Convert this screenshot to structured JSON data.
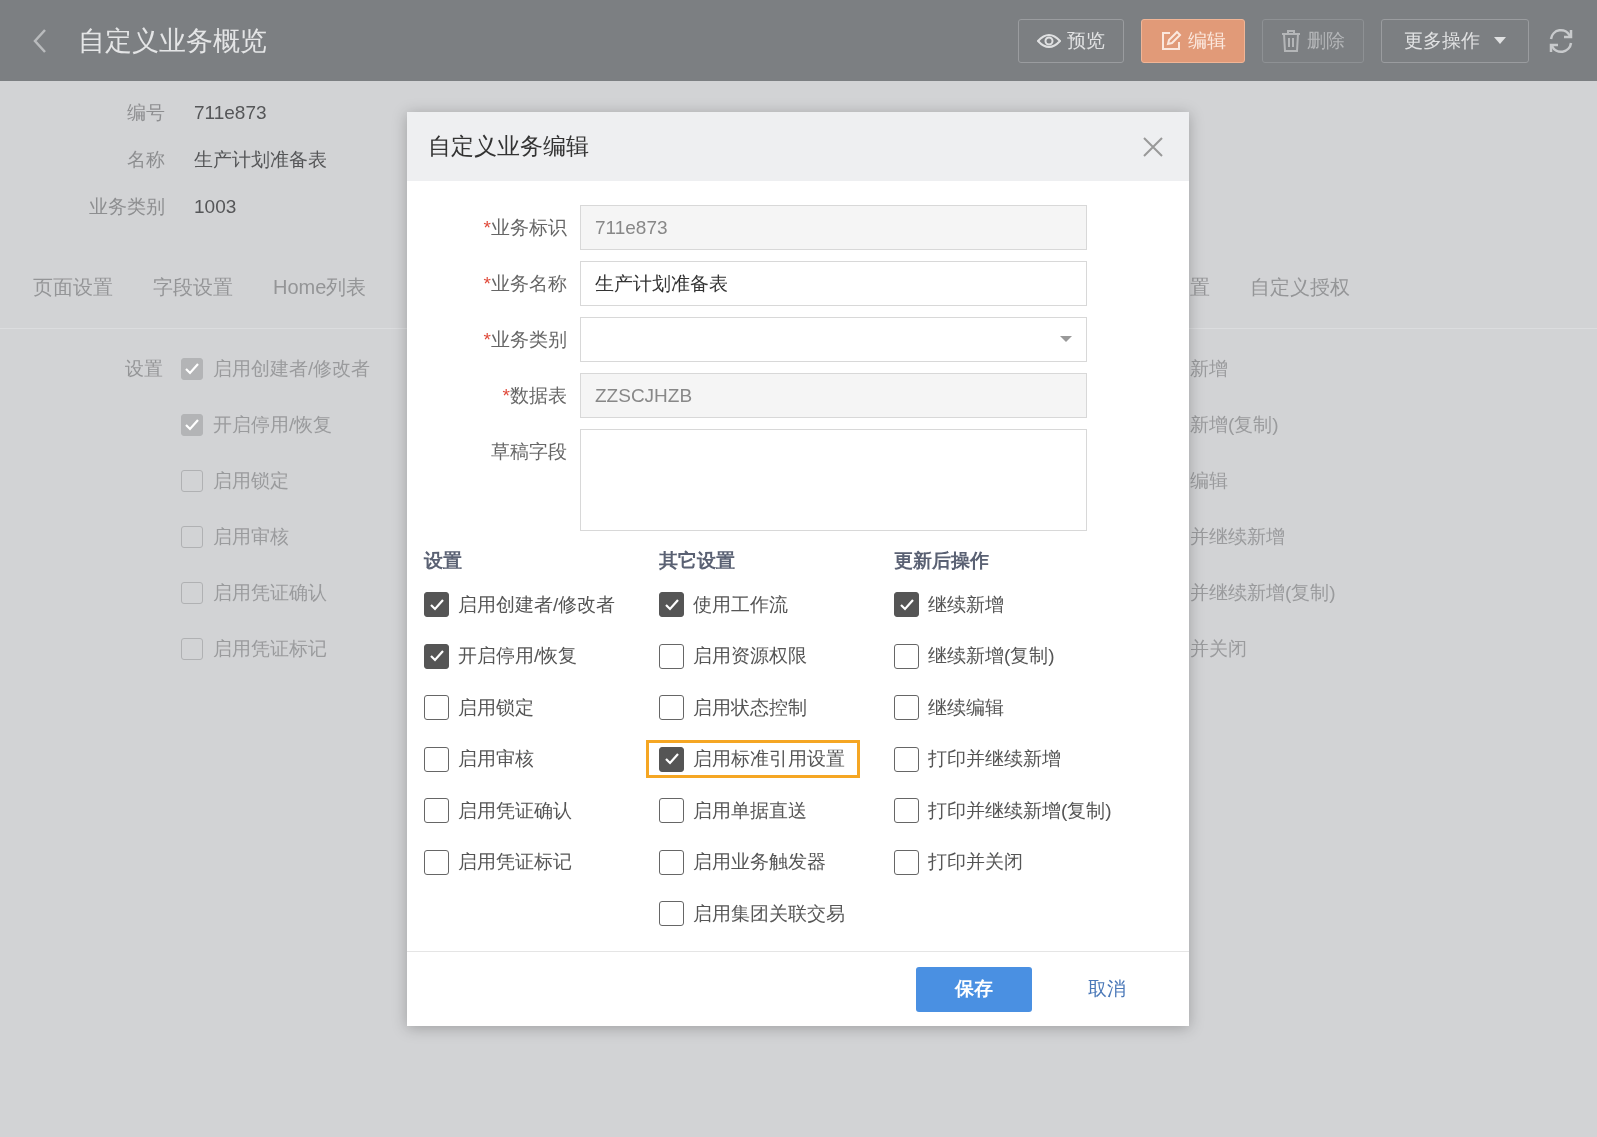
{
  "header": {
    "title": "自定义业务概览",
    "actions": [
      {
        "label": "预览",
        "kind": "view",
        "disabled": false
      },
      {
        "label": "编辑",
        "kind": "edit",
        "disabled": false
      },
      {
        "label": "删除",
        "kind": "delete",
        "disabled": true
      },
      {
        "label": "更多操作",
        "kind": "menu",
        "disabled": false
      }
    ]
  },
  "info": [
    {
      "label": "编号",
      "value": "711e873"
    },
    {
      "label": "名称",
      "value": "生产计划准备表"
    },
    {
      "label": "业务类别",
      "value": "1003"
    }
  ],
  "tabs_left": [
    {
      "label": "页面设置"
    },
    {
      "label": "字段设置"
    },
    {
      "label": "Home列表"
    }
  ],
  "tabs_right": [
    {
      "label": "置"
    },
    {
      "label": "自定义授权"
    }
  ],
  "settings": {
    "label": "设置",
    "items": [
      {
        "label": "启用创建者/修改者",
        "checked": true
      },
      {
        "label": "开启停用/恢复",
        "checked": true
      },
      {
        "label": "启用锁定",
        "checked": false
      },
      {
        "label": "启用审核",
        "checked": false
      },
      {
        "label": "启用凭证确认",
        "checked": false
      },
      {
        "label": "启用凭证标记",
        "checked": false
      }
    ]
  },
  "settings_right": [
    "新增",
    "新增(复制)",
    "编辑",
    "并继续新增",
    "并继续新增(复制)",
    "并关闭"
  ],
  "dialog": {
    "title": "自定义业务编辑",
    "fields": [
      {
        "label": "业务标识",
        "required_mark": "*",
        "kind": "readonly",
        "value": "711e873"
      },
      {
        "label": "业务名称",
        "required_mark": "*",
        "kind": "text",
        "value": "生产计划准备表"
      },
      {
        "label": "业务类别",
        "required_mark": "*",
        "kind": "select"
      },
      {
        "label": "数据表",
        "required_mark": "*",
        "kind": "readonly",
        "value": "ZZSCJHZB"
      },
      {
        "label": "草稿字段",
        "kind": "textarea"
      }
    ],
    "groups": [
      {
        "title": "设置",
        "items": [
          {
            "label": "启用创建者/修改者",
            "checked": true,
            "highlighted": false
          },
          {
            "label": "开启停用/恢复",
            "checked": true,
            "highlighted": false
          },
          {
            "label": "启用锁定",
            "checked": false,
            "highlighted": false
          },
          {
            "label": "启用审核",
            "checked": false,
            "highlighted": false
          },
          {
            "label": "启用凭证确认",
            "checked": false,
            "highlighted": false
          },
          {
            "label": "启用凭证标记",
            "checked": false,
            "highlighted": false
          }
        ]
      },
      {
        "title": "其它设置",
        "items": [
          {
            "label": "使用工作流",
            "checked": true,
            "highlighted": false
          },
          {
            "label": "启用资源权限",
            "checked": false,
            "highlighted": false
          },
          {
            "label": "启用状态控制",
            "checked": false,
            "highlighted": false
          },
          {
            "label": "启用标准引用设置",
            "checked": true,
            "highlighted": true
          },
          {
            "label": "启用单据直送",
            "checked": false,
            "highlighted": false
          },
          {
            "label": "启用业务触发器",
            "checked": false,
            "highlighted": false
          },
          {
            "label": "启用集团关联交易",
            "checked": false,
            "highlighted": false
          }
        ]
      },
      {
        "title": "更新后操作",
        "items": [
          {
            "label": "继续新增",
            "checked": true,
            "highlighted": false
          },
          {
            "label": "继续新增(复制)",
            "checked": false,
            "highlighted": false
          },
          {
            "label": "继续编辑",
            "checked": false,
            "highlighted": false
          },
          {
            "label": "打印并继续新增",
            "checked": false,
            "highlighted": false
          },
          {
            "label": "打印并继续新增(复制)",
            "checked": false,
            "highlighted": false
          },
          {
            "label": "打印并关闭",
            "checked": false,
            "highlighted": false
          }
        ]
      }
    ],
    "buttons": [
      {
        "label": "保存",
        "kind": "primary"
      },
      {
        "label": "取消",
        "kind": "text"
      }
    ]
  }
}
